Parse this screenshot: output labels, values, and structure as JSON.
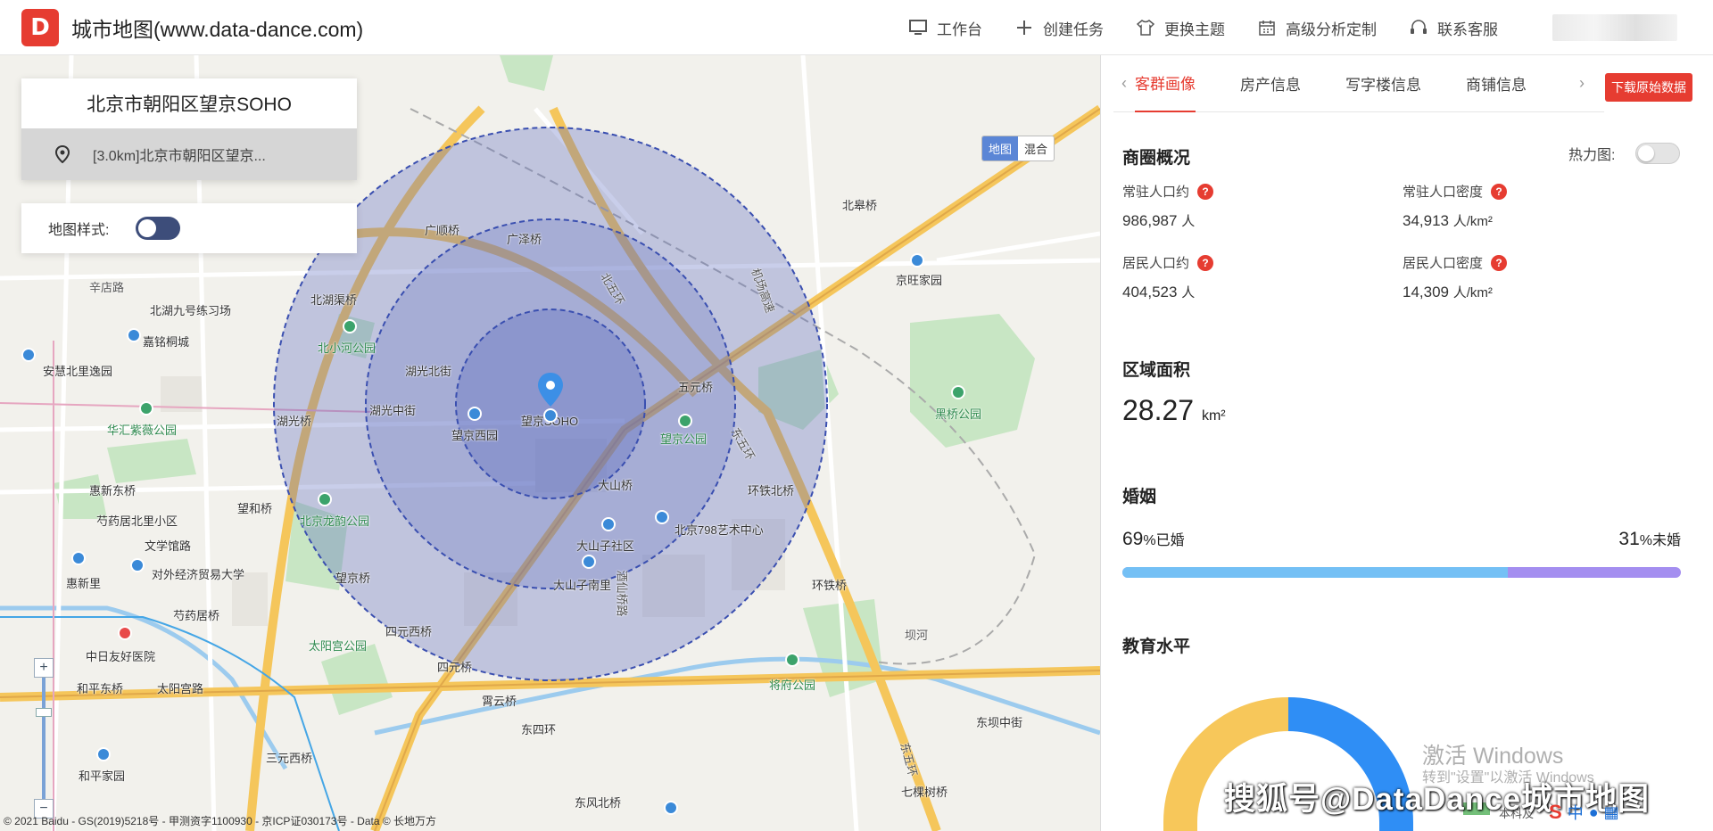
{
  "header": {
    "logo_text": "D",
    "title": "城市地图(www.data-dance.com)",
    "nav": [
      {
        "icon": "monitor-icon",
        "label": "工作台"
      },
      {
        "icon": "plus-icon",
        "label": "创建任务"
      },
      {
        "icon": "shirt-icon",
        "label": "更换主题"
      },
      {
        "icon": "calendar-icon",
        "label": "高级分析定制"
      },
      {
        "icon": "headset-icon",
        "label": "联系客服"
      }
    ]
  },
  "map": {
    "search_title": "北京市朝阳区望京SOHO",
    "search_result": "[3.0km]北京市朝阳区望京...",
    "style_label": "地图样式:",
    "maptype": {
      "map": "地图",
      "hybrid": "混合"
    },
    "copyright": "© 2021 Baidu - GS(2019)5218号 - 甲测资字1100930 - 京ICP证030173号 - Data © 长地万方",
    "center_label": "望京SOHO",
    "labels": [
      {
        "text": "辛店路"
      },
      {
        "text": "北湖九号练习场"
      },
      {
        "text": "嘉铭桐城"
      },
      {
        "text": "安慧北里逸园"
      },
      {
        "text": "华汇紫薇公园"
      },
      {
        "text": "惠新东桥"
      },
      {
        "text": "芍药居北里小区"
      },
      {
        "text": "文学馆路"
      },
      {
        "text": "惠新里"
      },
      {
        "text": "对外经济贸易大学"
      },
      {
        "text": "芍药居桥"
      },
      {
        "text": "中日友好医院"
      },
      {
        "text": "和平东桥"
      },
      {
        "text": "太阳宫路"
      },
      {
        "text": "三元西桥"
      },
      {
        "text": "和平家园"
      },
      {
        "text": "广顺桥"
      },
      {
        "text": "广泽桥"
      },
      {
        "text": "湖光北街"
      },
      {
        "text": "湖光中街"
      },
      {
        "text": "湖光桥"
      },
      {
        "text": "北湖渠桥"
      },
      {
        "text": "北小河公园"
      },
      {
        "text": "望京西园"
      },
      {
        "text": "望和桥"
      },
      {
        "text": "北京龙韵公园"
      },
      {
        "text": "望京桥"
      },
      {
        "text": "四元西桥"
      },
      {
        "text": "太阳宫公园"
      },
      {
        "text": "四元桥"
      },
      {
        "text": "霄云桥"
      },
      {
        "text": "东四环"
      },
      {
        "text": "五元桥"
      },
      {
        "text": "望京公园"
      },
      {
        "text": "大山桥"
      },
      {
        "text": "大山子社区"
      },
      {
        "text": "北京798艺术中心"
      },
      {
        "text": "大山子南里"
      },
      {
        "text": "环铁北桥"
      },
      {
        "text": "环铁桥"
      },
      {
        "text": "将府公园"
      },
      {
        "text": "坝河"
      },
      {
        "text": "东坝中街"
      },
      {
        "text": "七棵树桥"
      },
      {
        "text": "东风北桥"
      },
      {
        "text": "北皋桥"
      },
      {
        "text": "京旺家园"
      },
      {
        "text": "黑桥公园"
      },
      {
        "text": "东五环"
      },
      {
        "text": "北五环"
      },
      {
        "text": "机场高速"
      },
      {
        "text": "酒仙桥路"
      },
      {
        "text": "东五环"
      }
    ]
  },
  "panel": {
    "tabs": [
      "客群画像",
      "房产信息",
      "写字楼信息",
      "商铺信息"
    ],
    "download": "下载原始数据",
    "overview_title": "商圈概况",
    "heatmap_label": "热力图:",
    "stats": [
      {
        "label": "常驻人口约",
        "value": "986,987",
        "unit": "人"
      },
      {
        "label": "常驻人口密度",
        "value": "34,913",
        "unit": "人/km²"
      },
      {
        "label": "居民人口约",
        "value": "404,523",
        "unit": "人"
      },
      {
        "label": "居民人口密度",
        "value": "14,309",
        "unit": "人/km²"
      }
    ],
    "area_title": "区域面积",
    "area_value": "28.27",
    "area_unit": "km²",
    "marriage_title": "婚姻",
    "married_pct": "69",
    "married_label": "%已婚",
    "unmarried_pct": "31",
    "unmarried_label": "%未婚",
    "married_fraction": 0.69,
    "education_title": "教育水平",
    "colors": {
      "accent": "#e63c31",
      "married": "#74c0f5",
      "unmarried": "#a48ef0",
      "ring": "#5a6ec4"
    }
  },
  "overlay": {
    "watermark_line1": "激活 Windows",
    "watermark_line2": "转到\"设置\"以激活 Windows",
    "sohu": "搜狐号@DataDance城市地图",
    "legend_cut": "本科及",
    "ime": "中"
  }
}
